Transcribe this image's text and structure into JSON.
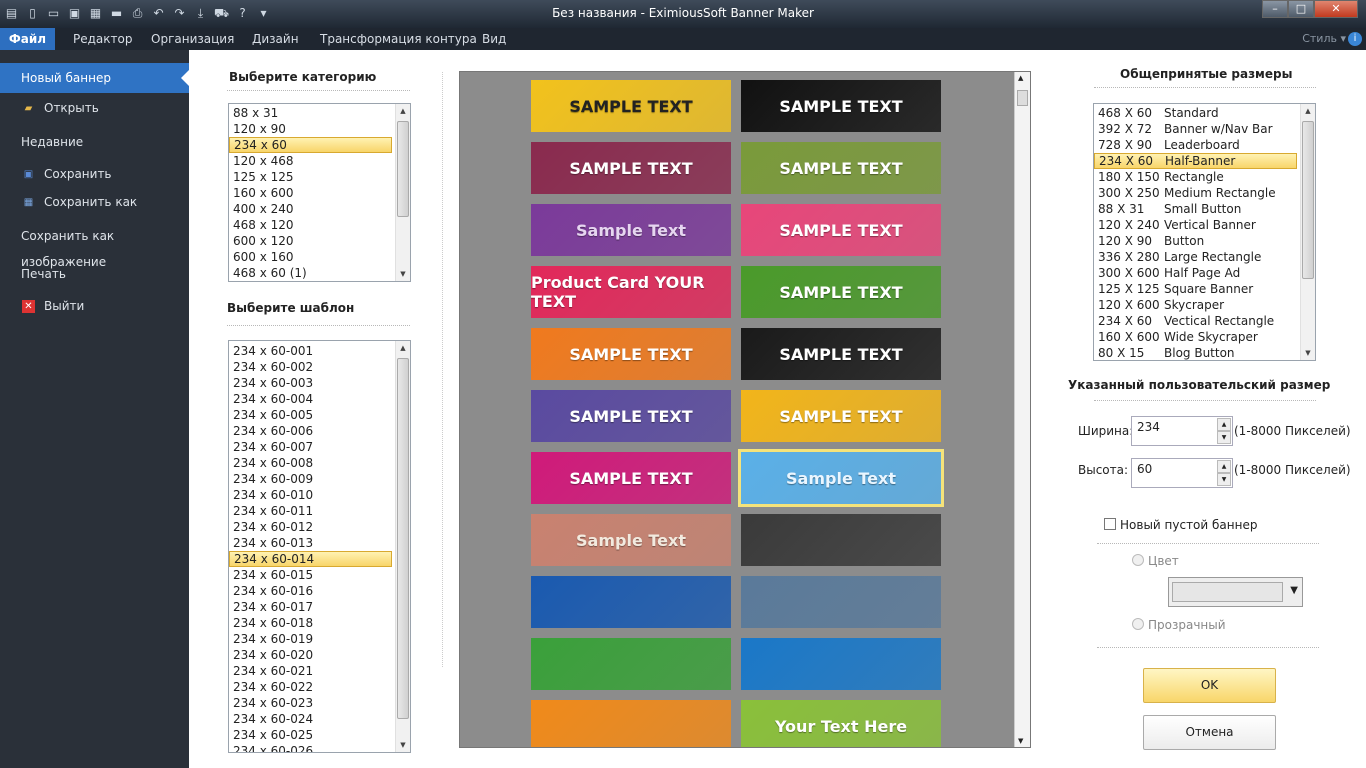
{
  "window": {
    "title": "Без названия - EximiousSoft Banner Maker"
  },
  "ribbon": {
    "tabs": [
      "Файл",
      "Редактор",
      "Организация",
      "Дизайн",
      "Трансформация контура",
      "Вид"
    ],
    "style_label": "Стиль"
  },
  "sidebar": {
    "items": [
      {
        "label": "Новый баннер",
        "icon": ""
      },
      {
        "label": "Открыть",
        "icon": "folder-icon"
      },
      {
        "label": "Недавние",
        "icon": ""
      },
      {
        "label": "Сохранить",
        "icon": "floppy-icon"
      },
      {
        "label": "Сохранить как",
        "icon": "save-as-icon"
      },
      {
        "label": "Сохранить как изображение",
        "icon": ""
      },
      {
        "label": "Печать",
        "icon": ""
      },
      {
        "label": "Выйти",
        "icon": "exit-icon"
      }
    ]
  },
  "category": {
    "heading": "Выберите категорию",
    "items": [
      "88 x 31",
      "120 x 90",
      "234 x 60",
      "120 x 468",
      "125 x 125",
      "160 x 600",
      "400 x 240",
      "468 x 120",
      "600 x 120",
      "600 x 160",
      "468 x 60 (1)"
    ],
    "selected": 2
  },
  "template": {
    "heading": "Выберите шаблон",
    "items": [
      "234 x 60-001",
      "234 x 60-002",
      "234 x 60-003",
      "234 x 60-004",
      "234 x 60-005",
      "234 x 60-006",
      "234 x 60-007",
      "234 x 60-008",
      "234 x 60-009",
      "234 x 60-010",
      "234 x 60-011",
      "234 x 60-012",
      "234 x 60-013",
      "234 x 60-014",
      "234 x 60-015",
      "234 x 60-016",
      "234 x 60-017",
      "234 x 60-018",
      "234 x 60-019",
      "234 x 60-020",
      "234 x 60-021",
      "234 x 60-022",
      "234 x 60-023",
      "234 x 60-024",
      "234 x 60-025",
      "234 x 60-026"
    ],
    "selected": 13
  },
  "gallery": {
    "tiles": [
      {
        "text": "SAMPLE TEXT",
        "bg": "#f2c21c",
        "fg": "#222"
      },
      {
        "text": "SAMPLE TEXT",
        "bg": "#111111",
        "fg": "#fff"
      },
      {
        "text": "SAMPLE TEXT",
        "bg": "#8a2a4e",
        "fg": "#fff"
      },
      {
        "text": "SAMPLE TEXT",
        "bg": "#7a9a3a",
        "fg": "#fff"
      },
      {
        "text": "Sample Text",
        "bg": "#7b3a9a",
        "fg": "#e6d6f0"
      },
      {
        "text": "SAMPLE TEXT",
        "bg": "#e8467a",
        "fg": "#fff"
      },
      {
        "text": "Product Card YOUR TEXT",
        "bg": "#e2285a",
        "fg": "#fff"
      },
      {
        "text": "SAMPLE TEXT",
        "bg": "#4a9a2a",
        "fg": "#fff"
      },
      {
        "text": "SAMPLE TEXT",
        "bg": "#f07a1e",
        "fg": "#fff"
      },
      {
        "text": "SAMPLE TEXT",
        "bg": "#1a1a1a",
        "fg": "#fff"
      },
      {
        "text": "SAMPLE TEXT",
        "bg": "#5a4aa0",
        "fg": "#fff"
      },
      {
        "text": "SAMPLE TEXT",
        "bg": "#f2b51a",
        "fg": "#fff"
      },
      {
        "text": "SAMPLE TEXT",
        "bg": "#d01a7a",
        "fg": "#fff"
      },
      {
        "text": "Sample Text",
        "bg": "#5ab0e8",
        "fg": "#eaf6ff"
      },
      {
        "text": "Sample Text",
        "bg": "#c98270",
        "fg": "#f2eadf"
      },
      {
        "text": "",
        "bg": "#3a3a3a",
        "fg": "#fff"
      },
      {
        "text": "",
        "bg": "#1a5ab0",
        "fg": "#fff"
      },
      {
        "text": "",
        "bg": "#5a7a9a",
        "fg": "#fff"
      },
      {
        "text": "",
        "bg": "#3aa03a",
        "fg": "#fff"
      },
      {
        "text": "",
        "bg": "#1a78c8",
        "fg": "#fff"
      },
      {
        "text": "",
        "bg": "#f08a1a",
        "fg": "#fff"
      },
      {
        "text": "Your Text Here",
        "bg": "#8ac03a",
        "fg": "#fff"
      }
    ]
  },
  "sizes": {
    "heading": "Общепринятые размеры",
    "items": [
      [
        "468 X 60",
        "Standard"
      ],
      [
        "392 X 72",
        "Banner w/Nav Bar"
      ],
      [
        "728 X 90",
        "Leaderboard"
      ],
      [
        "234 X 60",
        "Half-Banner"
      ],
      [
        "180 X 150",
        "Rectangle"
      ],
      [
        "300 X 250",
        "Medium Rectangle"
      ],
      [
        "88 X 31",
        "Small Button"
      ],
      [
        "120 X 240",
        "Vertical Banner"
      ],
      [
        "120 X 90",
        "Button"
      ],
      [
        "336 X 280",
        "Large Rectangle"
      ],
      [
        "300 X 600",
        "Half Page Ad"
      ],
      [
        "125 X 125",
        "Square Banner"
      ],
      [
        "120 X 600",
        "Skycraper"
      ],
      [
        "234 X 60",
        "Vectical Rectangle"
      ],
      [
        "160 X 600",
        "Wide Skycraper"
      ],
      [
        "80 X 15",
        "Blog Button"
      ]
    ],
    "selected": 3
  },
  "custom": {
    "heading": "Указанный пользовательский размер",
    "width_label": "Ширина:",
    "width_value": "234",
    "height_label": "Высота:",
    "height_value": "60",
    "range": "(1-8000 Пикселей)"
  },
  "options": {
    "empty_banner": "Новый пустой баннер",
    "color_label": "Цвет",
    "transparent_label": "Прозрачный"
  },
  "buttons": {
    "ok": "OK",
    "cancel": "Отмена"
  }
}
